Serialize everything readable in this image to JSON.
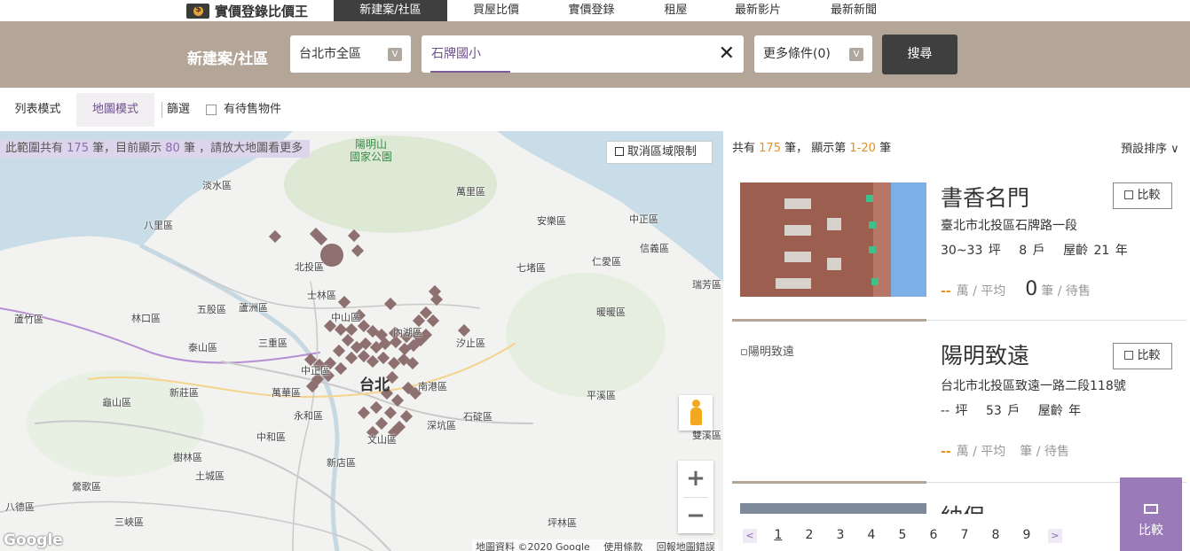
{
  "logo": {
    "text": "實價登錄比價王"
  },
  "nav": [
    "新建案/社區",
    "買屋比價",
    "實價登錄",
    "租屋",
    "最新影片",
    "最新新聞"
  ],
  "search": {
    "title": "新建案/社區",
    "area_select": "台北市全區",
    "keyword": "石牌國小",
    "more": "更多條件(0)",
    "submit": "搜尋",
    "select_marker": "V",
    "clear_icon": "✕"
  },
  "modes": {
    "list": "列表模式",
    "map": "地圖模式",
    "filter": "篩選",
    "pending": "有待售物件"
  },
  "map": {
    "info_pre": "此範圍共有",
    "info_total": "175",
    "info_mid": "筆，目前顯示",
    "info_shown": "80",
    "info_post": "筆 ，請放大地圖看更多",
    "cancel_limit": "取消區域限制",
    "park_line1": "陽明山",
    "park_line2": "國家公園",
    "center_label": "台北",
    "districts": [
      "淡水區",
      "萬里區",
      "八里區",
      "安樂區",
      "中正區",
      "信義區",
      "北投區",
      "七堵區",
      "仁愛區",
      "瑞芳區",
      "士林區",
      "蘆竹區",
      "林口區",
      "五股區",
      "蘆洲區",
      "中山區",
      "內湖區",
      "暖暖區",
      "泰山區",
      "三重區",
      "汐止區",
      "中正區",
      "南港區",
      "新莊區",
      "萬華區",
      "平溪區",
      "龜山區",
      "永和區",
      "石碇區",
      "深坑區",
      "雙溪區",
      "中和區",
      "文山區",
      "樹林區",
      "新店區",
      "土城區",
      "鶯歌區",
      "八德區",
      "三峽區",
      "坪林區"
    ],
    "google": "Google",
    "attribution": [
      "地圖資料 ©2020 Google",
      "使用條款",
      "回報地圖錯誤"
    ],
    "zoom_in": "+",
    "zoom_out": "−",
    "theme": {
      "marker": "#8f7070",
      "road": "#c9c9c9",
      "purple_road": "#b58fd3",
      "yellow_road": "#f5d38a",
      "water": "#c9dde8",
      "green": "#dde9d5",
      "park_text": "#3a8a4a"
    }
  },
  "list": {
    "pre": "共有",
    "total": "175",
    "mid": "筆， 顯示第",
    "range": "1-20",
    "post": "筆",
    "sort": "預設排序 ∨",
    "items": [
      {
        "title": "書香名門",
        "address": "臺北市北投區石牌路一段",
        "area": "30~33 坪",
        "units": "8 戶",
        "age": "屋齡 21 年",
        "price": "--",
        "price_unit": "萬 / 平均",
        "pending": "0",
        "pending_unit": "筆 / 待售",
        "compare": "比較"
      },
      {
        "title": "陽明致遠",
        "photo_alt": "陽明致遠",
        "address": "台北市北投區致遠一路二段118號",
        "area": "-- 坪",
        "units": "53 戶",
        "age": "屋齡 年",
        "price": "--",
        "price_unit": "萬 / 平均",
        "pending_unit": "筆 / 待售",
        "compare": "比較"
      },
      {
        "title": "紬保"
      }
    ],
    "pages": [
      "1",
      "2",
      "3",
      "4",
      "5",
      "6",
      "7",
      "8",
      "9"
    ],
    "prev": "<",
    "next": ">",
    "float_compare": "比較"
  }
}
